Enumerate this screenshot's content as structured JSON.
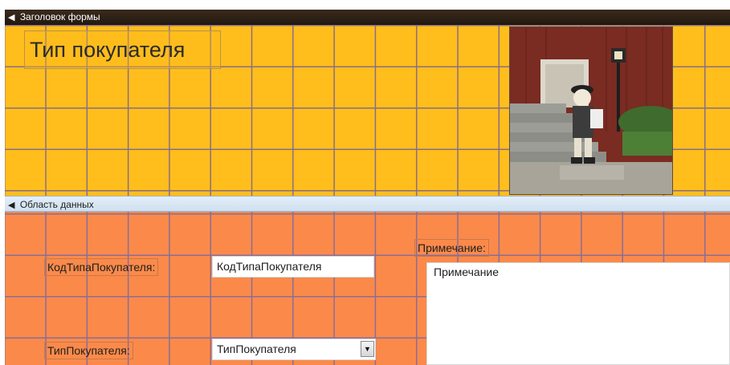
{
  "sections": {
    "header_label": "Заголовок формы",
    "detail_label": "Область данных"
  },
  "form": {
    "title": "Тип покупателя"
  },
  "fields": {
    "code_label": "КодТипаПокупателя:",
    "code_value": "КодТипаПокупателя",
    "type_label": "ТипПокупателя:",
    "type_value": "ТипПокупателя",
    "note_label": "Примечание:",
    "note_value": "Примечание"
  },
  "colors": {
    "header_background": "#ffbe1c",
    "detail_background": "#fb8a4a",
    "grid_lines": "#8a6d86",
    "header_bar": "#2b1f14",
    "detail_bar": "#dbe7f4"
  },
  "icons": {
    "section_marker": "section-arrow-icon",
    "combo_dropdown": "dropdown-arrow-icon"
  }
}
